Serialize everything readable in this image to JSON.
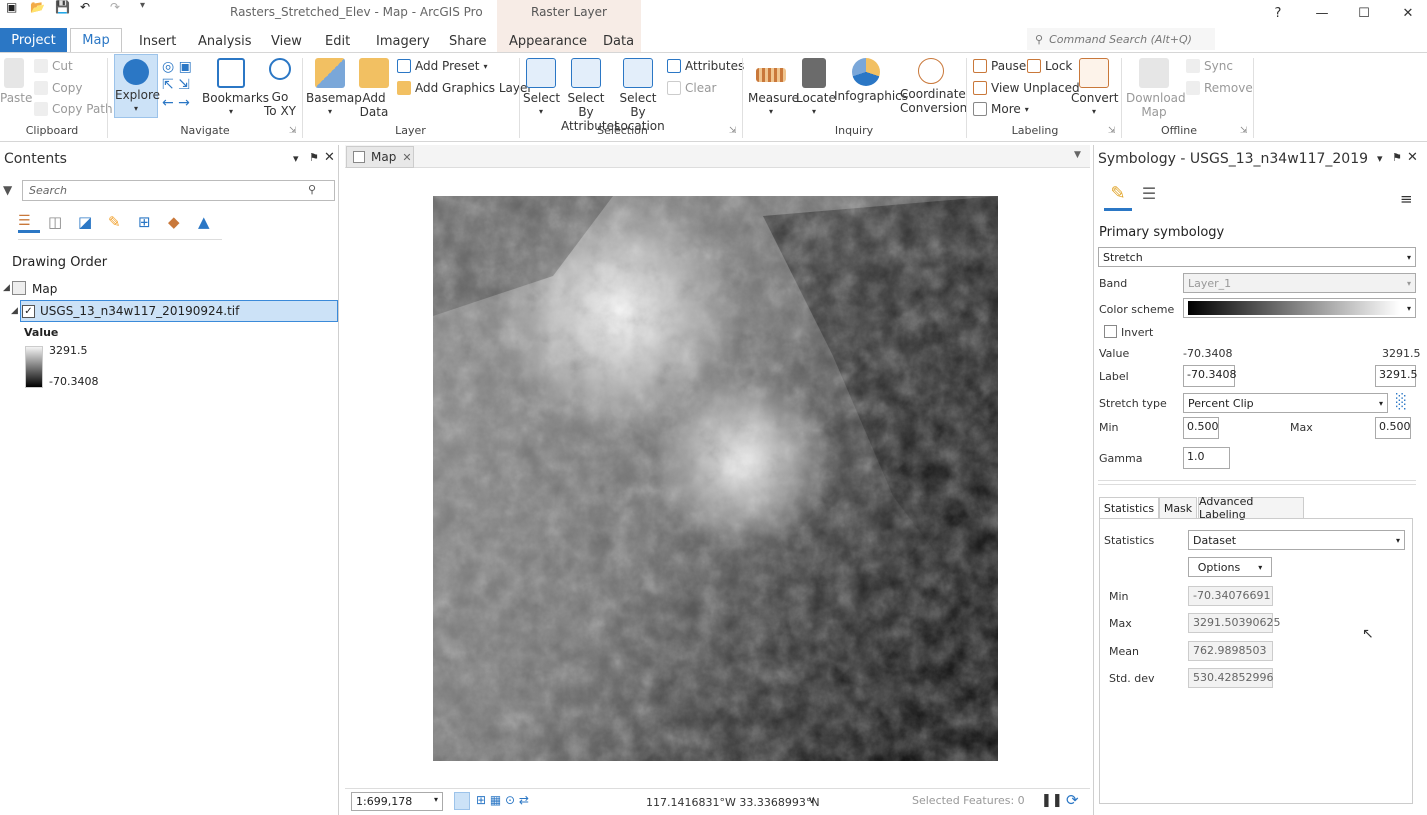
{
  "window": {
    "title": "Rasters_Stretched_Elev - Map - ArcGIS Pro",
    "context_tab_group": "Raster Layer",
    "help": "?",
    "minimize": "—",
    "maximize": "☐",
    "close": "✕"
  },
  "ribbon_tabs": [
    "Project",
    "Map",
    "Insert",
    "Analysis",
    "View",
    "Edit",
    "Imagery",
    "Share",
    "Appearance",
    "Data"
  ],
  "command_search": {
    "placeholder": "Command Search (Alt+Q)"
  },
  "clipboard": {
    "paste": "Paste",
    "cut": "Cut",
    "copy": "Copy",
    "copy_path": "Copy Path",
    "group": "Clipboard"
  },
  "navigate": {
    "explore": "Explore",
    "bookmarks": "Bookmarks",
    "go_to_xy": "Go\nTo XY",
    "group": "Navigate"
  },
  "layer": {
    "basemap": "Basemap",
    "add_data": "Add\nData",
    "add_preset": "Add Preset",
    "add_graphics_layer": "Add Graphics Layer",
    "group": "Layer"
  },
  "selection": {
    "select": "Select",
    "select_by_attributes": "Select By\nAttributes",
    "select_by_location": "Select By\nLocation",
    "attributes": "Attributes",
    "clear": "Clear",
    "group": "Selection"
  },
  "inquiry": {
    "measure": "Measure",
    "locate": "Locate",
    "infographics": "Infographics",
    "coordinate_conversion": "Coordinate\nConversion",
    "group": "Inquiry"
  },
  "labeling": {
    "pause": "Pause",
    "lock": "Lock",
    "view_unplaced": "View Unplaced",
    "more": "More",
    "convert": "Convert",
    "group": "Labeling"
  },
  "offline": {
    "download_map": "Download\nMap",
    "sync": "Sync",
    "remove": "Remove",
    "group": "Offline"
  },
  "contents": {
    "title": "Contents",
    "search_placeholder": "Search",
    "drawing_order": "Drawing Order",
    "map_node": "Map",
    "layer_name": "USGS_13_n34w117_20190924.tif",
    "legend_heading": "Value",
    "legend_high": "3291.5",
    "legend_low": "-70.3408"
  },
  "map": {
    "tab": "Map",
    "scale": "1:699,178",
    "coordinates": "117.1416831°W 33.3368993°N",
    "selected_features": "Selected Features: 0"
  },
  "symbology": {
    "title": "Symbology - USGS_13_n34w117_2019...",
    "primary": "Primary symbology",
    "renderer": "Stretch",
    "band_label": "Band",
    "band": "Layer_1",
    "color_scheme_label": "Color scheme",
    "invert": "Invert",
    "value_label": "Value",
    "value_low": "-70.3408",
    "value_high": "3291.5",
    "label_label": "Label",
    "label_low": "-70.3408",
    "label_high": "3291.5",
    "stretch_type_label": "Stretch type",
    "stretch_type": "Percent Clip",
    "min_label": "Min",
    "min": "0.500",
    "max_label": "Max",
    "max": "0.500",
    "gamma_label": "Gamma",
    "gamma": "1.0",
    "tabs": [
      "Statistics",
      "Mask",
      "Advanced Labeling"
    ],
    "statistics_label": "Statistics",
    "statistics_source": "Dataset",
    "options": "Options",
    "stats": [
      {
        "name": "Min",
        "value": "-70.34076691"
      },
      {
        "name": "Max",
        "value": "3291.50390625"
      },
      {
        "name": "Mean",
        "value": "762.9898503"
      },
      {
        "name": "Std. dev",
        "value": "530.42852996"
      }
    ]
  },
  "colors": {
    "accent": "#2b77c5",
    "selection": "#cce2f7",
    "context_tab": "#f7ece6"
  }
}
